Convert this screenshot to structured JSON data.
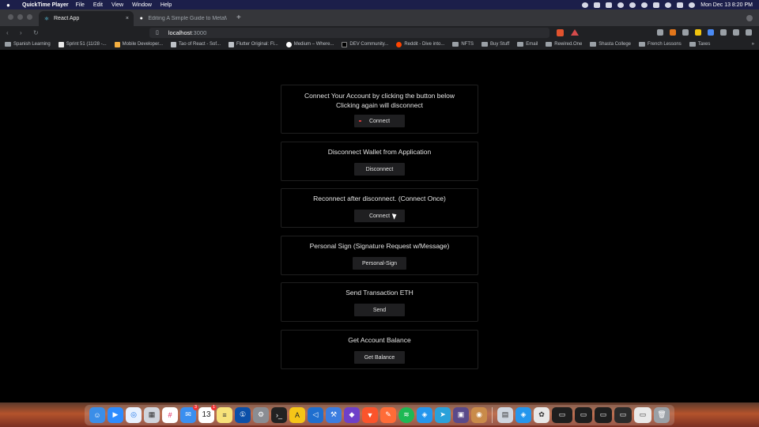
{
  "menubar": {
    "app_name": "QuickTime Player",
    "items": [
      "File",
      "Edit",
      "View",
      "Window",
      "Help"
    ],
    "clock": "Mon Dec 13  8:20 PM"
  },
  "browser": {
    "tabs": [
      {
        "label": "React App",
        "close": "×"
      },
      {
        "label": "Editing A Simple Guide to MetaM..."
      }
    ],
    "new_tab": "+",
    "address": {
      "host": "localhost",
      "port": ":3000"
    },
    "bookmarks": [
      "Spanish Learning",
      "Sprint 51 (11/28 -...",
      "Mobile Developer...",
      "Tao of React - Sof...",
      "Flutter Original: Fl...",
      "Medium – Where...",
      "DEV Community...",
      "Reddit - Dive into...",
      "NFTS",
      "Buy Stuff",
      "Email",
      "Rewired.One",
      "Shasta College",
      "French Lessons",
      "Taxes"
    ],
    "bookmarks_more": "»"
  },
  "cards": [
    {
      "title_line1": "Connect Your Account by clicking the button below",
      "title_line2": "Clicking again will disconnect",
      "button": "Connect"
    },
    {
      "title_line1": "Disconnect Wallet from Application",
      "button": "Disconnect"
    },
    {
      "title_line1": "Reconnect after disconnect. (Connect Once)",
      "button": "Connect"
    },
    {
      "title_line1": "Personal Sign (Signature Request w/Message)",
      "button": "Personal-Sign"
    },
    {
      "title_line1": "Send Transaction ETH",
      "button": "Send"
    },
    {
      "title_line1": "Get Account Balance",
      "button": "Get Balance"
    }
  ],
  "dock": {
    "calendar_day": "13",
    "badges": {
      "mail": "3",
      "calendar": "1"
    }
  },
  "colors": {
    "menubar": "#1c1f4a",
    "page_bg": "#000000",
    "button_bg": "#1f1f21",
    "card_border": "#1f1f1f"
  }
}
